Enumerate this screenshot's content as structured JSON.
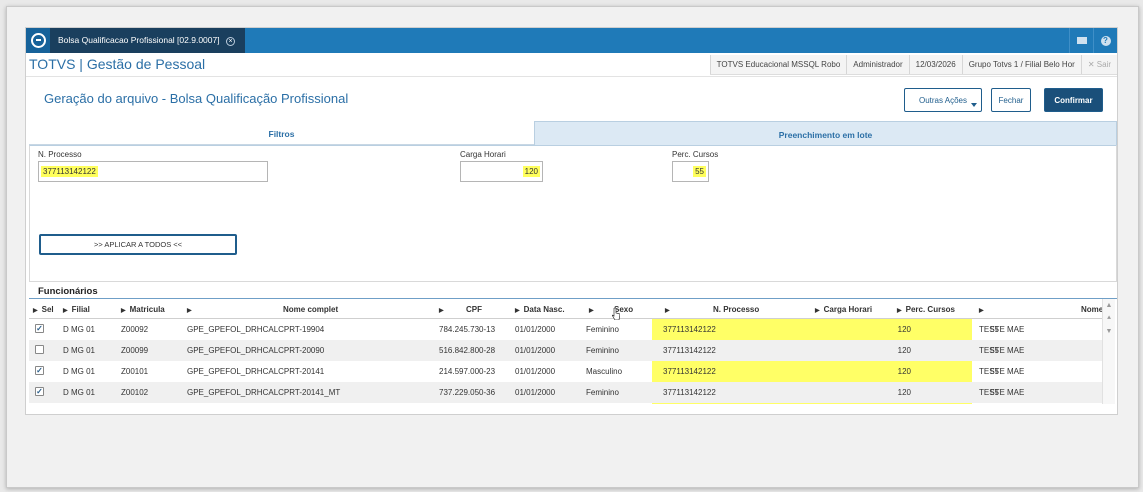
{
  "window": {
    "tab_title": "Bolsa Qualificacao Profissional [02.9.0007]",
    "brand": "TOTVS | Gestão de Pessoal"
  },
  "status_bar": [
    "TOTVS Educacional MSSQL Robo",
    "Administrador",
    "12/03/2026",
    "Grupo Totvs 1 / Filial Belo Hor",
    "Sair"
  ],
  "page": {
    "title": "Geração do arquivo - Bolsa Qualificação Profissional",
    "outras_acoes": "Outras Ações",
    "fechar": "Fechar",
    "confirmar": "Confirmar"
  },
  "tabs": [
    "Filtros",
    "Preenchimento em lote"
  ],
  "form": {
    "n_processo_label": "N. Processo",
    "n_processo_value": "377113142122",
    "carga_label": "Carga Horari",
    "carga_value": "120",
    "perc_label": "Perc. Cursos",
    "perc_value": "55",
    "aplicar": ">> APLICAR A TODOS <<"
  },
  "grid": {
    "title": "Funcionários",
    "headers": [
      "Sel",
      "Filial",
      "Matricula",
      "Nome complet",
      "CPF",
      "Data Nasc.",
      "Sexo",
      "N. Processo",
      "Carga Horari",
      "Perc. Cursos",
      "Nome"
    ],
    "rows": [
      {
        "sel": true,
        "filial": "D MG 01",
        "matricula": "Z00092",
        "nome": "GPE_GPEFOL_DRHCALCPRT-19904",
        "cpf": "784.245.730-13",
        "nasc": "01/01/2000",
        "sexo": "Feminino",
        "processo": "377113142122",
        "carga": "120",
        "perc": "55",
        "nome2": "TESTE MAE"
      },
      {
        "sel": false,
        "filial": "D MG 01",
        "matricula": "Z00099",
        "nome": "GPE_GPEFOL_DRHCALCPRT-20090",
        "cpf": "516.842.800-28",
        "nasc": "01/01/2000",
        "sexo": "Feminino",
        "processo": "377113142122",
        "carga": "120",
        "perc": "55",
        "nome2": "TESTE MAE"
      },
      {
        "sel": true,
        "filial": "D MG 01",
        "matricula": "Z00101",
        "nome": "GPE_GPEFOL_DRHCALCPRT-20141",
        "cpf": "214.597.000-23",
        "nasc": "01/01/2000",
        "sexo": "Masculino",
        "processo": "377113142122",
        "carga": "120",
        "perc": "55",
        "nome2": "TESTE MAE"
      },
      {
        "sel": true,
        "filial": "D MG 01",
        "matricula": "Z00102",
        "nome": "GPE_GPEFOL_DRHCALCPRT-20141_MT",
        "cpf": "737.229.050-36",
        "nasc": "01/01/2000",
        "sexo": "Feminino",
        "processo": "377113142122",
        "carga": "120",
        "perc": "55",
        "nome2": "TESTE MAE"
      }
    ]
  },
  "colors": {
    "primary": "#1f7ab8",
    "dark": "#1a4f7a",
    "highlight": "#ffff66"
  }
}
